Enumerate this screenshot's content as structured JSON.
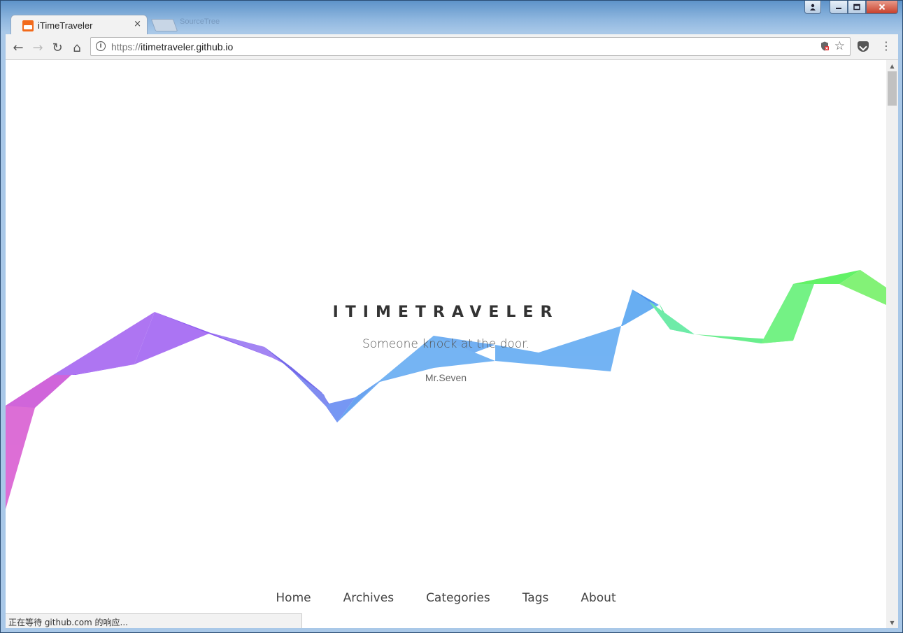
{
  "window": {
    "controls": [
      "user",
      "minimize",
      "maximize",
      "close"
    ]
  },
  "tab": {
    "title": "iTimeTraveler",
    "close_label": "×",
    "ghost_label": "SourceTree"
  },
  "toolbar": {
    "url_scheme": "https://",
    "url_host": "itimetraveler.github.io",
    "back_glyph": "←",
    "forward_glyph": "→",
    "reload_glyph": "↻",
    "home_glyph": "⌂",
    "star_glyph": "☆",
    "menu_glyph": "⋮",
    "info_glyph": "i"
  },
  "hero": {
    "title": "ITIMETRAVELER",
    "subtitle": "Someone knock at the door.",
    "author": "Mr.Seven"
  },
  "nav": {
    "items": [
      "Home",
      "Archives",
      "Categories",
      "Tags",
      "About"
    ]
  },
  "status": {
    "text": "正在等待 github.com 的响应..."
  },
  "ribbon_colors": {
    "start": "#d85ad0",
    "purple": "#a46cf0",
    "blue": "#5aa4f0",
    "green": "#5cf07a"
  }
}
